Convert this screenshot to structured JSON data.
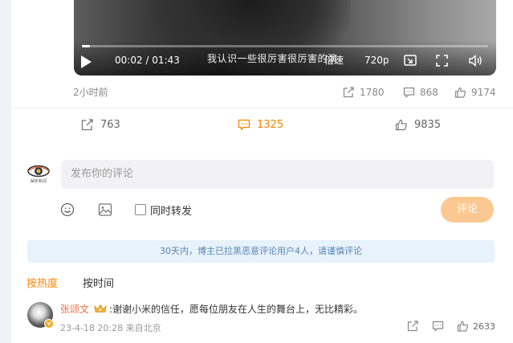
{
  "video": {
    "current_time": "00:02",
    "separator": "/",
    "duration": "01:43",
    "progress": 0.02,
    "subtitle": "我认识一些很厉害很厉害的演",
    "speed_label": "倍速",
    "quality_label": "720p"
  },
  "post": {
    "time_ago": "2小时前",
    "video_stats": {
      "shares": "1780",
      "comments": "868",
      "likes": "9174"
    },
    "actions": {
      "repost": "763",
      "comment": "1325",
      "like": "9835"
    }
  },
  "composer": {
    "placeholder": "发布你的评论",
    "also_repost_label": "同时转发",
    "submit_label": "评论",
    "avatar_caption": "解析新闻"
  },
  "notice": "30天内，博主已拉黑恶意评论用户4人，请谨慎评论",
  "sort": {
    "by_hot": "按热度",
    "by_time": "按时间"
  },
  "comment": {
    "user_name": "张颂文",
    "text": ":谢谢小米的信任，愿每位朋友在人生的舞台上，无比精彩。",
    "time": "23-4-18 20:28",
    "location": "来自北京",
    "likes": "2633",
    "badge": "v"
  },
  "colors": {
    "accent": "#ff8200",
    "link_orange": "#eb7350",
    "submit_disabled": "#fcc891",
    "notice_bg": "#e7f2fb",
    "notice_text": "#5b86b5"
  }
}
